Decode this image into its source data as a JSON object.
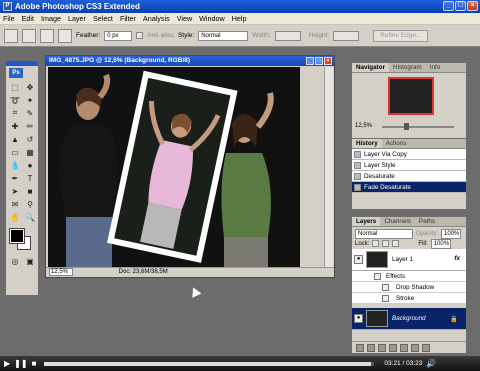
{
  "window": {
    "title": "Adobe Photoshop CS3 Extended",
    "controls": [
      "_",
      "□",
      "×"
    ]
  },
  "menu": [
    "File",
    "Edit",
    "Image",
    "Layer",
    "Select",
    "Filter",
    "Analysis",
    "View",
    "Window",
    "Help"
  ],
  "options": {
    "feather_label": "Feather:",
    "feather_value": "0 px",
    "antialias_label": "Anti-alias",
    "style_label": "Style:",
    "style_value": "Normal",
    "width_label": "Width:",
    "height_label": "Height:",
    "refine_label": "Refine Edge..."
  },
  "toolbox": {
    "logo": "Ps"
  },
  "document": {
    "title": "IMG_4875.JPG @ 12,5% (Background, RGB/8)",
    "zoom": "12,5%",
    "doc_info": "Doc: 23,6M/38,5M"
  },
  "navigator": {
    "tabs": [
      "Navigator",
      "Histogram",
      "Info"
    ],
    "zoom": "12,5%"
  },
  "history": {
    "tabs": [
      "History",
      "Actions"
    ],
    "items": [
      "Layer Via Copy",
      "Layer Style",
      "Desaturate",
      "Fade Desaturate"
    ],
    "selected_index": 3
  },
  "layers": {
    "tabs": [
      "Layers",
      "Channels",
      "Paths"
    ],
    "blend_mode": "Normal",
    "opacity_label": "Opacity:",
    "opacity_value": "100%",
    "lock_label": "Lock:",
    "fill_label": "Fill:",
    "fill_value": "100%",
    "layer1_name": "Layer 1",
    "fx_label": "fx",
    "effects_label": "Effects",
    "effect_items": [
      "Drop Shadow",
      "Stroke"
    ],
    "background_name": "Background"
  },
  "player": {
    "time": "03:21 / 03:23",
    "progress": 0.99
  },
  "colors": {
    "title_blue": "#1448b8",
    "selection_navy": "#0a246a",
    "workspace_gray": "#6c6c6c"
  }
}
